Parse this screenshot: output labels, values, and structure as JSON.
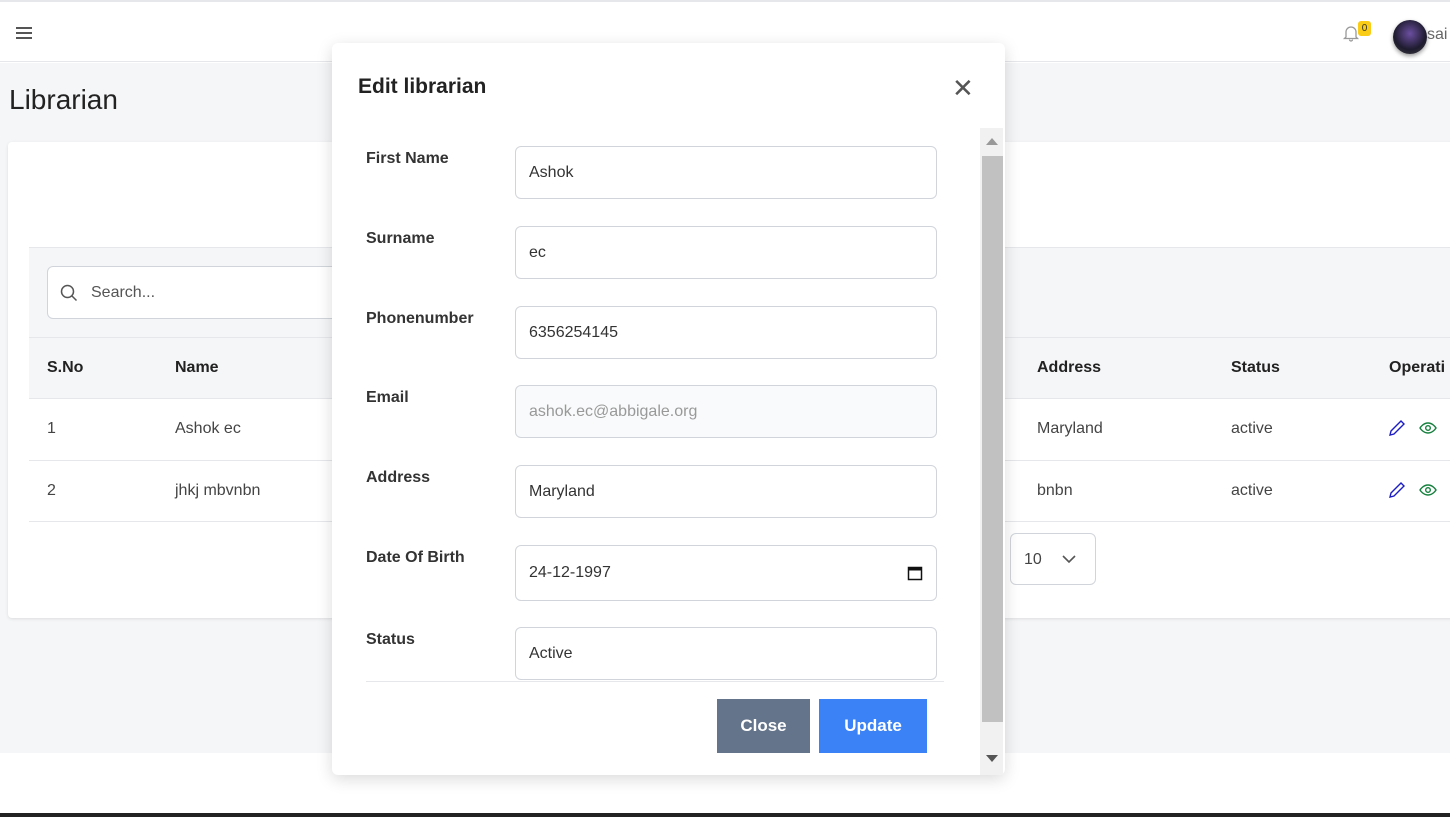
{
  "header": {
    "menu_icon": "hamburger-icon",
    "notification_count": "0",
    "username": "sai"
  },
  "page": {
    "title": "Librarian"
  },
  "search": {
    "placeholder": "Search..."
  },
  "table": {
    "columns": [
      "S.No",
      "Name",
      "Address",
      "Status",
      "Operati"
    ],
    "rows": [
      {
        "sno": "1",
        "name": "Ashok ec",
        "address": "Maryland",
        "status": "active"
      },
      {
        "sno": "2",
        "name": "jhkj mbvnbn",
        "address": "bnbn",
        "status": "active"
      }
    ],
    "page_size": "10"
  },
  "modal": {
    "title": "Edit librarian",
    "fields": [
      {
        "label": "First Name",
        "value": "Ashok"
      },
      {
        "label": "Surname",
        "value": "ec"
      },
      {
        "label": "Phonenumber",
        "value": "6356254145"
      },
      {
        "label": "Email",
        "value": "ashok.ec@abbigale.org"
      },
      {
        "label": "Address",
        "value": "Maryland"
      },
      {
        "label": "Date Of Birth",
        "value": "24-12-1997"
      },
      {
        "label": "Status",
        "value": "Active"
      }
    ],
    "close_label": "Close",
    "update_label": "Update"
  },
  "colors": {
    "close_button": "#64748b",
    "update_button": "#3b82f6",
    "edit_icon": "#1d1dc4",
    "view_icon": "#15803d",
    "badge": "#facc15"
  }
}
